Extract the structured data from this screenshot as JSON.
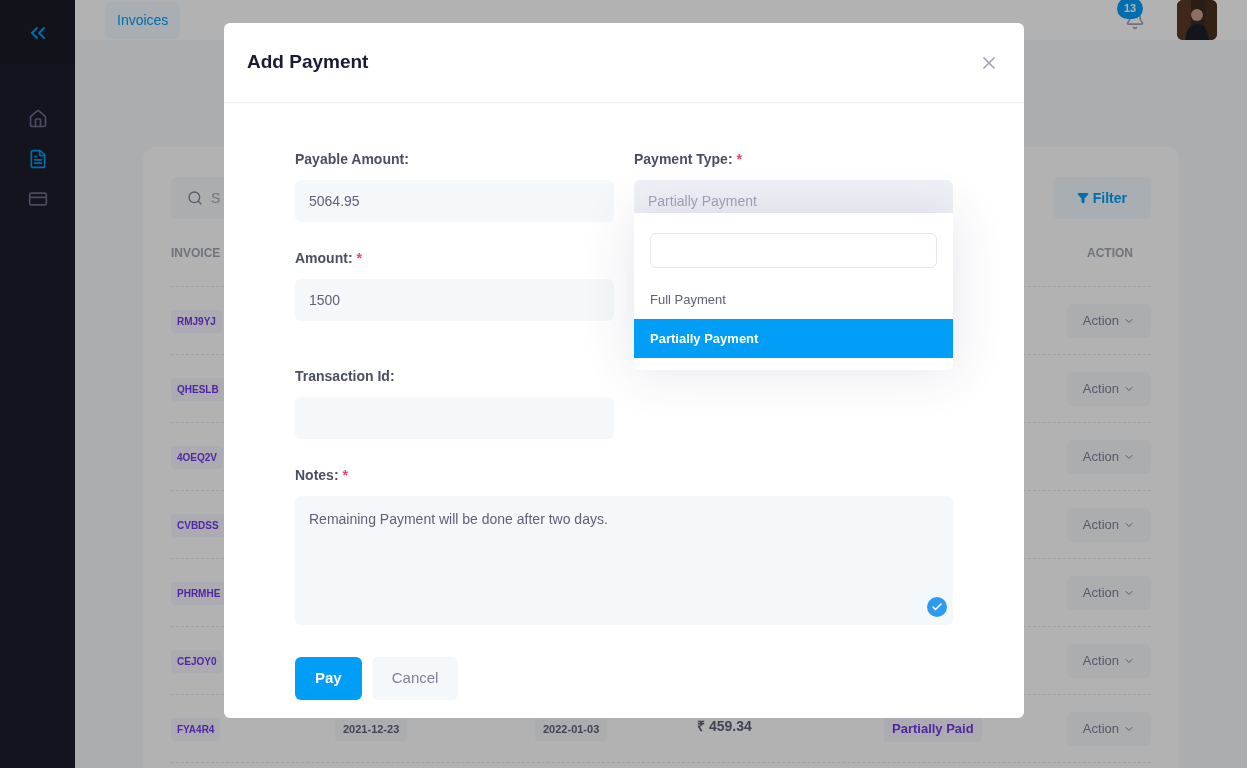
{
  "header": {
    "breadcrumb": "Invoices",
    "notifications": "13"
  },
  "sidebar": {
    "items": [
      {
        "kind": "home",
        "selected": false
      },
      {
        "kind": "document",
        "selected": true
      },
      {
        "kind": "card",
        "selected": false
      }
    ]
  },
  "invoices": {
    "search": {
      "placeholder": "S"
    },
    "filter": "Filter",
    "columns": {
      "column_1": "INVOICE",
      "column_6": "ACTION"
    },
    "rows": [
      {
        "invoice": "RMJ9YJ",
        "action": "Action"
      },
      {
        "invoice": "QHESLB",
        "action": "Action"
      },
      {
        "invoice": "4OEQ2V",
        "action": "Action"
      },
      {
        "invoice": "CVBDSS",
        "action": "Action"
      },
      {
        "invoice": "PHRMHE",
        "action": "Action"
      },
      {
        "invoice": "CEJOY0",
        "action": "Action"
      },
      {
        "invoice": "FYA4R4",
        "invoice_date": "2021-12-23",
        "due_date": "2022-01-03",
        "amount": "₹ 459.34",
        "status": "Partially Paid",
        "action": "Action"
      }
    ]
  },
  "dialog": {
    "title": "Add Payment",
    "payable_amount": {
      "label": "Payable Amount:",
      "value": "5064.95"
    },
    "payment_type": {
      "label": "Payment Type:",
      "required_mark": "*",
      "value": "Partially Payment",
      "expanded": true,
      "options": [
        {
          "label": "Full Payment",
          "selected": false
        },
        {
          "label": "Partially Payment",
          "selected": true
        }
      ]
    },
    "amount": {
      "label": "Amount:",
      "value": "1500",
      "required_mark": "*"
    },
    "transaction_id": {
      "label": "Transaction Id:"
    },
    "notes": {
      "label": "Notes:",
      "value": "Remaining Payment will be done after two days.",
      "required_mark": "*"
    },
    "buttons": {
      "pay": "Pay",
      "cancel": "Cancel"
    }
  }
}
